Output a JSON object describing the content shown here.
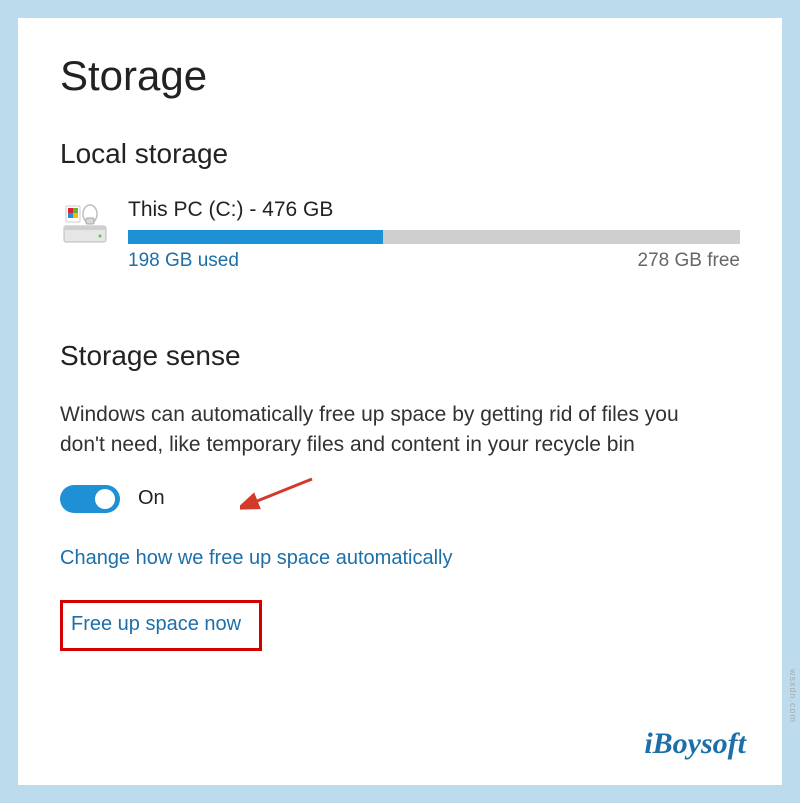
{
  "page": {
    "title": "Storage"
  },
  "local_storage": {
    "heading": "Local storage",
    "drive": {
      "label": "This PC (C:) - 476 GB",
      "used_text": "198 GB used",
      "free_text": "278 GB free",
      "used_percent": 41.6
    }
  },
  "storage_sense": {
    "heading": "Storage sense",
    "description": "Windows can automatically free up space by getting rid of files you don't need, like temporary files and content in your recycle bin",
    "toggle_state": "On",
    "link_change": "Change how we free up space automatically",
    "link_free_now": "Free up space now"
  },
  "watermark": "iBoysoft",
  "source_note": "wsxdn.com"
}
